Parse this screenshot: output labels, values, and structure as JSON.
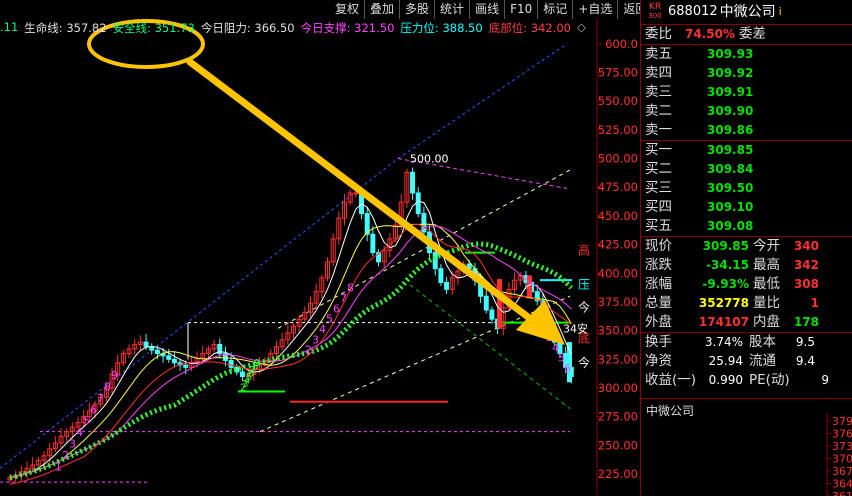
{
  "toolbar": [
    "复权",
    "叠加",
    "多股",
    "统计",
    "画线",
    "F10",
    "标记",
    "+自选",
    "返回"
  ],
  "indicator": [
    {
      "text": ".11",
      "color": "#00ff80"
    },
    {
      "text": "生命线: 357.82",
      "color": "#e0e0e0"
    },
    {
      "text": "安全线: 351.73",
      "color": "#00ff80"
    },
    {
      "text": "今日阻力: 366.50",
      "color": "#e0e0e0"
    },
    {
      "text": "今日支撑: 321.50",
      "color": "#ff40ff"
    },
    {
      "text": "压力位: 388.50",
      "color": "#00ffff"
    },
    {
      "text": "底部位: 342.00",
      "color": "#ff4040"
    }
  ],
  "price_axis": {
    "labels": [
      "600.0",
      "575.00",
      "550.00",
      "525.00",
      "500.00",
      "475.00",
      "450.00",
      "425.00",
      "400.00",
      "375.00",
      "350.00",
      "325.00",
      "300.00",
      "275.00",
      "250.00",
      "225.00"
    ],
    "values": [
      600,
      575,
      550,
      525,
      500,
      475,
      450,
      425,
      400,
      375,
      350,
      325,
      300,
      275,
      250,
      225
    ],
    "min": 212,
    "max": 612
  },
  "chart_labels": {
    "peak": "500.00",
    "gao": "高",
    "ya": "压",
    "jin1": "今",
    "an": "34安",
    "di": "底",
    "jin2": "今",
    "seq_pink": [
      "1",
      "2",
      "3",
      "4",
      "5",
      "6",
      "7",
      "8",
      "9"
    ],
    "seq_green": [
      "2",
      "3",
      "4",
      "5",
      "6",
      "7",
      "8",
      "9"
    ],
    "seq_pink2": [
      "2",
      "3",
      "4",
      "5",
      "6",
      "7",
      "8"
    ],
    "seq_pink3": [
      "2",
      "3",
      "4",
      "5",
      "6"
    ]
  },
  "stock": {
    "badge_top": "KR",
    "badge_bottom": "300",
    "code": "688012",
    "name": "中微公司",
    "info": "i"
  },
  "order_ratio": {
    "label": "委比",
    "value": "74.50%",
    "label2": "委差"
  },
  "asks": [
    {
      "label": "卖五",
      "price": "309.93"
    },
    {
      "label": "卖四",
      "price": "309.92"
    },
    {
      "label": "卖三",
      "price": "309.91"
    },
    {
      "label": "卖二",
      "price": "309.90"
    },
    {
      "label": "卖一",
      "price": "309.86"
    }
  ],
  "bids": [
    {
      "label": "买一",
      "price": "309.85"
    },
    {
      "label": "买二",
      "price": "309.84"
    },
    {
      "label": "买三",
      "price": "309.50"
    },
    {
      "label": "买四",
      "price": "309.10"
    },
    {
      "label": "买五",
      "price": "309.08"
    }
  ],
  "quote": [
    {
      "l1": "现价",
      "v1": "309.85",
      "c1": "green",
      "l2": "今开",
      "v2": "340"
    },
    {
      "l1": "涨跌",
      "v1": "-34.15",
      "c1": "green",
      "l2": "最高",
      "v2": "342"
    },
    {
      "l1": "涨幅",
      "v1": "-9.93%",
      "c1": "green",
      "l2": "最低",
      "v2": "308"
    },
    {
      "l1": "总量",
      "v1": "352778",
      "c1": "yellow",
      "l2": "量比",
      "v2": "1"
    },
    {
      "l1": "外盘",
      "v1": "174107",
      "c1": "red",
      "l2": "内盘",
      "v2": "178"
    }
  ],
  "stats": [
    {
      "l1": "换手",
      "v1": "3.74%",
      "l2": "股本",
      "v2": "9.5"
    },
    {
      "l1": "净资",
      "v1": "25.94",
      "l2": "流通",
      "v2": "9.4"
    },
    {
      "l1": "收益(一)",
      "v1": "0.990",
      "l2": "PE(动)",
      "v2": "9"
    }
  ],
  "mini": {
    "title": "中微公司",
    "ticks": [
      "379",
      "376",
      "373",
      "370",
      "367",
      "364",
      "361"
    ]
  }
}
